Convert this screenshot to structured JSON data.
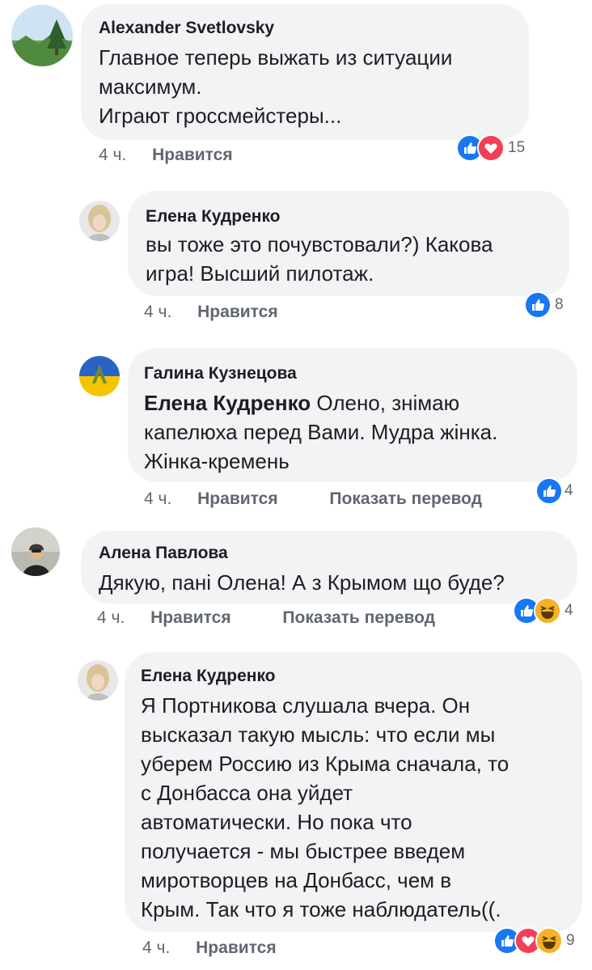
{
  "colors": {
    "like": "#1877f2",
    "love": "#f33e58",
    "haha": "#f7b125",
    "bubble": "#f2f3f5",
    "meta": "#606770"
  },
  "comments": [
    {
      "author": "Alexander Svetlovsky",
      "lines": [
        "Главное теперь выжать из ситуации",
        "максимум.",
        "Играют гроссмейстеры..."
      ],
      "time": "4 ч.",
      "like_label": "Нравится",
      "reactions": [
        "like-icon",
        "love-icon"
      ],
      "reaction_count": "15"
    },
    {
      "author": "Елена Кудренко",
      "lines": [
        "вы тоже это почувстовали?) Какова",
        "игра! Высший пилотаж."
      ],
      "time": "4 ч.",
      "like_label": "Нравится",
      "reactions": [
        "like-icon"
      ],
      "reaction_count": "8"
    },
    {
      "author": "Галина Кузнецова",
      "mention": "Елена Кудренко",
      "lines": [
        "Олено, знімаю",
        "капелюха перед Вами. Мудра жінка.",
        "Жінка-кремень"
      ],
      "time": "4 ч.",
      "like_label": "Нравится",
      "translate_label": "Показать перевод",
      "reactions": [
        "like-icon"
      ],
      "reaction_count": "4"
    },
    {
      "author": "Алена Павлова",
      "lines": [
        "Дякую, пані Олена! А з Крымом що буде?"
      ],
      "time": "4 ч.",
      "like_label": "Нравится",
      "translate_label": "Показать перевод",
      "reactions": [
        "like-icon",
        "haha-icon"
      ],
      "reaction_count": "4"
    },
    {
      "author": "Елена Кудренко",
      "lines": [
        "Я Портникова слушала вчера. Он",
        "высказал такую мысль: что если мы",
        "уберем Россию из Крыма сначала, то",
        "с Донбасса она уйдет",
        "автоматически. Но пока что",
        "получается - мы быстрее введем",
        "миротворцев на Донбасс, чем в",
        "Крым. Так что я тоже наблюдатель((."
      ],
      "time": "4 ч.",
      "like_label": "Нравится",
      "reactions": [
        "like-icon",
        "love-icon",
        "haha-icon"
      ],
      "reaction_count": "9"
    }
  ]
}
